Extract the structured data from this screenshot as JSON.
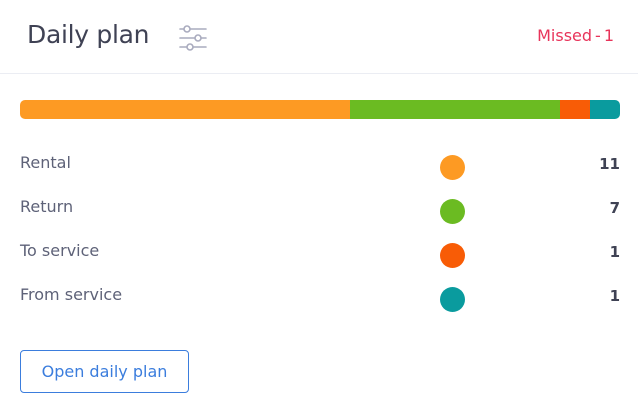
{
  "header": {
    "title": "Daily plan",
    "filter_icon": "sliders-icon",
    "missed_label": "Missed",
    "missed_separator": "-",
    "missed_count": "1",
    "missed_color": "#e8345a"
  },
  "progress": {
    "segments": [
      {
        "name": "Rental",
        "value": 11,
        "color": "#fd9a23"
      },
      {
        "name": "Return",
        "value": 7,
        "color": "#6bbb22"
      },
      {
        "name": "To service",
        "value": 1,
        "color": "#f85c06"
      },
      {
        "name": "From service",
        "value": 1,
        "color": "#0a9b9e"
      }
    ]
  },
  "items": [
    {
      "label": "Rental",
      "count": "11",
      "color": "#fd9a23"
    },
    {
      "label": "Return",
      "count": "7",
      "color": "#6bbb22"
    },
    {
      "label": "To service",
      "count": "1",
      "color": "#f85c06"
    },
    {
      "label": "From service",
      "count": "1",
      "color": "#0a9b9e"
    }
  ],
  "actions": {
    "open_label": "Open daily plan",
    "accent_color": "#3b7ddd"
  }
}
